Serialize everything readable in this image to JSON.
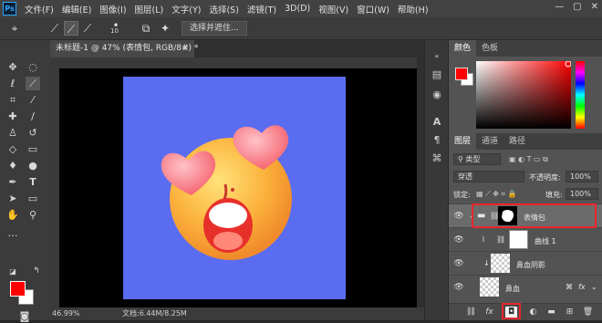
{
  "app": {
    "logo_text": "Ps",
    "accent": "#31a8ff"
  },
  "menu": [
    "文件(F)",
    "编辑(E)",
    "图像(I)",
    "图层(L)",
    "文字(Y)",
    "选择(S)",
    "滤镜(T)",
    "3D(D)",
    "视图(V)",
    "窗口(W)",
    "帮助(H)"
  ],
  "window_controls": [
    "—",
    "▢",
    "✕"
  ],
  "options_bar": {
    "brush_size": "10",
    "select_mask_label": "选择并遮住..."
  },
  "document": {
    "tab_title": "未标题-1 @ 47% (表情包, RGB/8#) *",
    "tab_close": "×",
    "canvas_color": "#5a6cf0"
  },
  "status": {
    "zoom": "46.99%",
    "doc_size": "文档:6.44M/8.25M"
  },
  "colors": {
    "foreground": "#ff0000",
    "background": "#ffffff"
  },
  "color_panel": {
    "tabs": [
      "颜色",
      "色板"
    ]
  },
  "layers_panel": {
    "tabs": [
      "图层",
      "通道",
      "路径"
    ],
    "filter_kind": "类型",
    "blend_mode": "穿透",
    "opacity_label": "不透明度:",
    "opacity_value": "100%",
    "lock_label": "锁定:",
    "fill_label": "填充:",
    "fill_value": "100%",
    "layers": [
      {
        "name": "表情包",
        "kind": "group",
        "selected": true
      },
      {
        "name": "曲线 1",
        "kind": "adjustment"
      },
      {
        "name": "鼻血阴影",
        "kind": "shape"
      },
      {
        "name": "鼻血",
        "kind": "shape",
        "fx": "fx"
      }
    ]
  },
  "footer_icons": [
    "link-icon",
    "fx-icon",
    "add-mask-icon",
    "adjustment-icon",
    "group-icon",
    "new-layer-icon",
    "trash-icon"
  ],
  "highlight_color": "#e8262c"
}
